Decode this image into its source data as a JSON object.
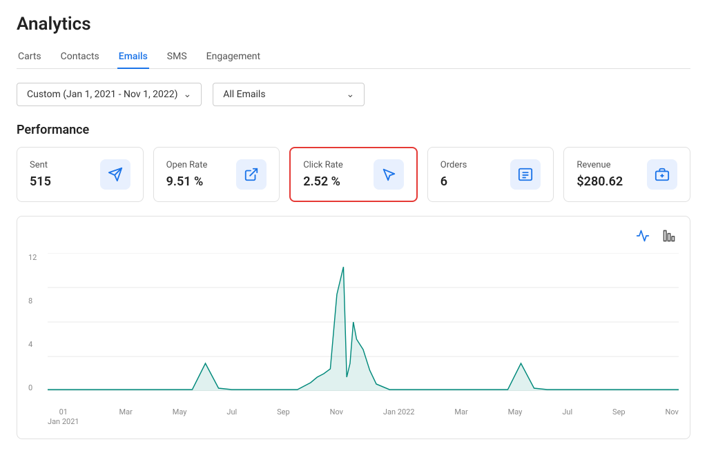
{
  "page": {
    "title": "Analytics"
  },
  "tabs": [
    {
      "label": "Carts",
      "active": false
    },
    {
      "label": "Contacts",
      "active": false
    },
    {
      "label": "Emails",
      "active": true
    },
    {
      "label": "SMS",
      "active": false
    },
    {
      "label": "Engagement",
      "active": false
    }
  ],
  "filters": {
    "date": {
      "label": "Custom (Jan 1, 2021 - Nov 1, 2022)"
    },
    "email": {
      "label": "All Emails"
    }
  },
  "performance": {
    "title": "Performance",
    "metrics": [
      {
        "id": "sent",
        "label": "Sent",
        "value": "515",
        "icon": "send-icon",
        "selected": false
      },
      {
        "id": "open-rate",
        "label": "Open Rate",
        "value": "9.51 %",
        "icon": "open-icon",
        "selected": false
      },
      {
        "id": "click-rate",
        "label": "Click Rate",
        "value": "2.52 %",
        "icon": "click-icon",
        "selected": true
      },
      {
        "id": "orders",
        "label": "Orders",
        "value": "6",
        "icon": "orders-icon",
        "selected": false
      },
      {
        "id": "revenue",
        "label": "Revenue",
        "value": "$280.62",
        "icon": "revenue-icon",
        "selected": false
      }
    ]
  },
  "chart": {
    "line_icon": "📈",
    "bar_icon": "📊",
    "y_labels": [
      "12",
      "8",
      "4",
      "0"
    ],
    "x_labels": [
      {
        "line1": "01",
        "line2": "Jan 2021"
      },
      {
        "line1": "",
        "line2": "Mar"
      },
      {
        "line1": "",
        "line2": "May"
      },
      {
        "line1": "",
        "line2": "Jul"
      },
      {
        "line1": "",
        "line2": "Sep"
      },
      {
        "line1": "",
        "line2": "Nov"
      },
      {
        "line1": "",
        "line2": "Jan 2022"
      },
      {
        "line1": "",
        "line2": "Mar"
      },
      {
        "line1": "",
        "line2": "May"
      },
      {
        "line1": "",
        "line2": "Jul"
      },
      {
        "line1": "",
        "line2": "Sep"
      },
      {
        "line1": "",
        "line2": "Nov"
      }
    ]
  }
}
